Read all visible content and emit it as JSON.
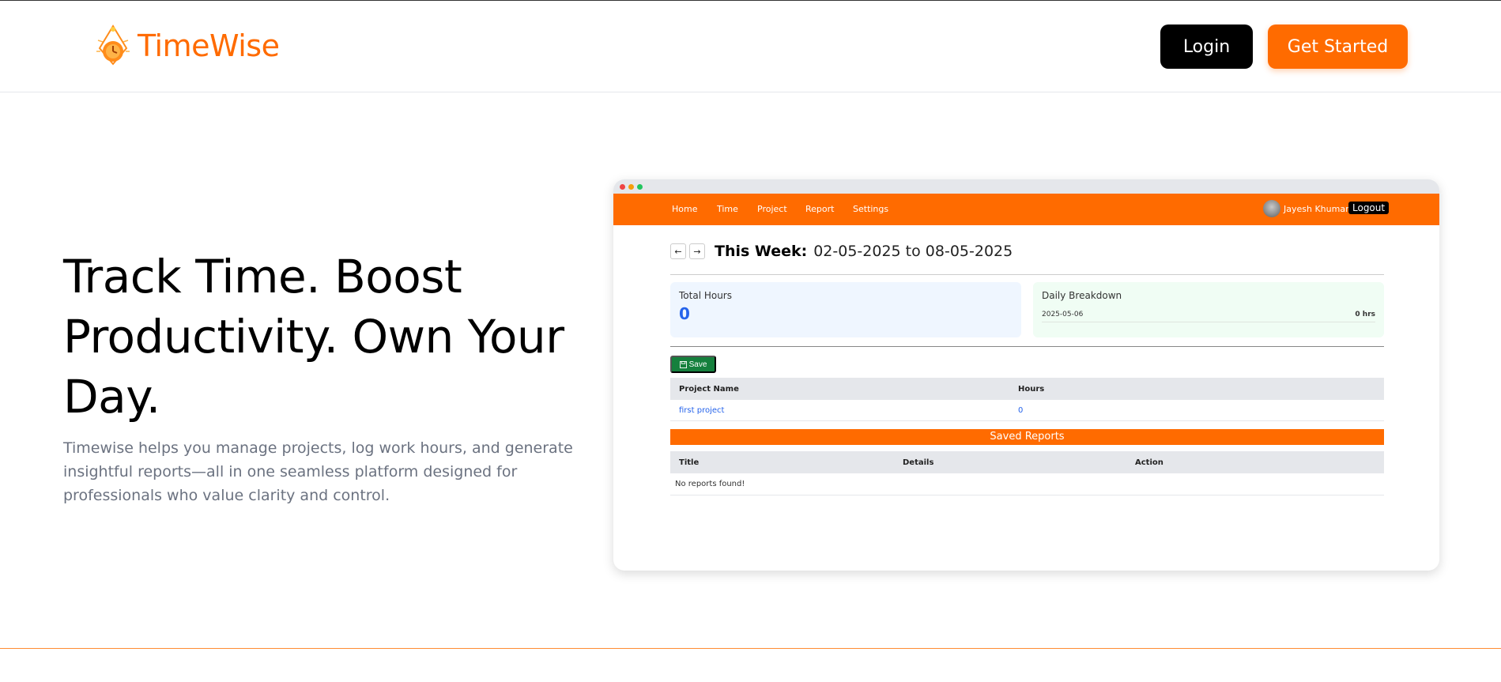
{
  "brand": {
    "name": "TimeWise",
    "accent": "#ff6b00"
  },
  "header": {
    "login_label": "Login",
    "get_started_label": "Get Started"
  },
  "hero": {
    "title": "Track Time. Boost Productivity. Own Your Day.",
    "description": "Timewise helps you manage projects, log work hours, and generate insightful reports—all in one seamless platform designed for professionals who value clarity and control."
  },
  "mock": {
    "nav": {
      "items": [
        "Home",
        "Time",
        "Project",
        "Report",
        "Settings"
      ],
      "user": "Jayesh Khuman",
      "logout": "Logout"
    },
    "week": {
      "label": "This Week:",
      "range": "02-05-2025 to 08-05-2025"
    },
    "total": {
      "label": "Total Hours",
      "value": "0"
    },
    "daily": {
      "title": "Daily Breakdown",
      "date": "2025-05-06",
      "hours": "0 hrs"
    },
    "save_label": "Save",
    "projects": {
      "headers": [
        "Project Name",
        "Hours"
      ],
      "rows": [
        {
          "name": "first project",
          "hours": "0"
        }
      ]
    },
    "saved_reports": {
      "title": "Saved Reports",
      "headers": [
        "Title",
        "Details",
        "Action"
      ],
      "empty": "No reports found!"
    }
  }
}
